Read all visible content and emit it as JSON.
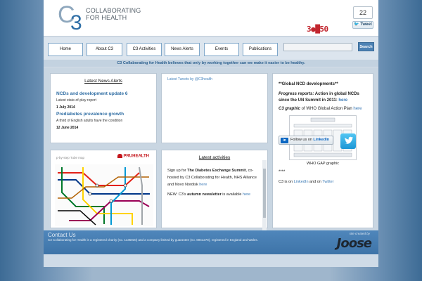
{
  "header": {
    "logo_mark_c": "C",
    "logo_mark_3": "3",
    "logo_line1": "COLLABORATING",
    "logo_line2": "FOR HEALTH",
    "share_count": "22",
    "tweet_label": "Tweet",
    "campaign_badge": "3●█50"
  },
  "nav": {
    "items": [
      "Home",
      "About C3",
      "C3 Activities",
      "News Alerts",
      "Events",
      "Publications"
    ],
    "search_placeholder": "",
    "search_button": "Search"
  },
  "tagline": "C3 Collaborating for Health believes that only by working together can we make it easier to be healthy.",
  "news": {
    "title": "Latest News Alerts",
    "items": [
      {
        "title": "NCDs and development update 6",
        "sub": "Latest state-of-play report",
        "date": "1 July 2014"
      },
      {
        "title": "Prediabetes prevalence growth",
        "sub": "A third of English adults have the condition",
        "date": "12 June 2014"
      }
    ]
  },
  "tweets": {
    "link": "Latest Tweets by @C3health"
  },
  "map_panel": {
    "caption": "p-by-step Tube map",
    "brand": "PRUHEALTH"
  },
  "activities": {
    "title": "Latest activities",
    "p1_a": "Sign up for ",
    "p1_bold": "The Diabetes Exchange Summit",
    "p1_b": ", co-hosted by C3 Collaborating for Health, NHS Alliance and Novo Nordisk ",
    "p1_link": "here",
    "p2_a": "NEW: C3's ",
    "p2_bold": "autumn newsletter",
    "p2_b": " is available ",
    "p2_link": "here"
  },
  "right": {
    "heading": "**Global NCD developments**",
    "progress_label": "Progress reports:",
    "progress_text": " Action in global NCDs since the UN Summit in 2011: ",
    "progress_link": "here",
    "graphic_label": "C3 graphic",
    "graphic_text": " of WHO Global Action Plan ",
    "graphic_link": "here",
    "gap_caption": "WHO GAP graphic",
    "stars": "****",
    "social_a": "C3 is on ",
    "social_linkedin": "LinkedIn",
    "social_b": " and on ",
    "social_twitter": "Twitter",
    "li_prefix": "Follow us on ",
    "li_word": "LinkedIn",
    "li_logo": "in"
  },
  "footer": {
    "contact": "Contact Us",
    "legal": "C3 Collaborating for Health is a registered charity (no. 1135930) and a company limited by guarantee (no. 6941278), registered in England and Wales.",
    "credit": "site created by",
    "brand": "Joose"
  }
}
